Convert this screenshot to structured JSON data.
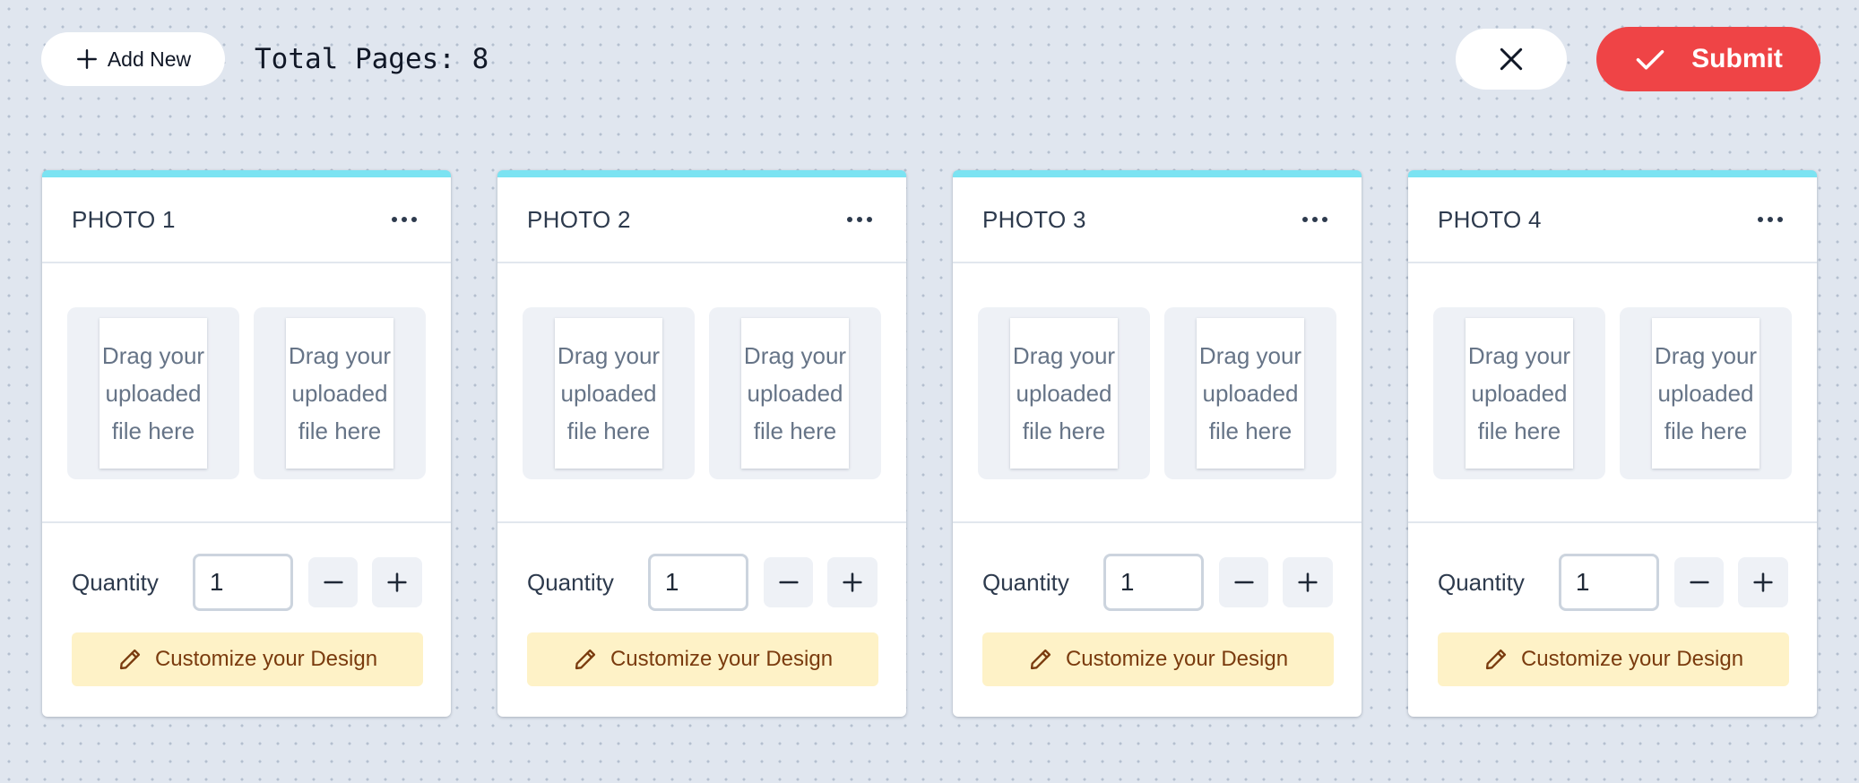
{
  "toolbar": {
    "add_new_label": "Add New",
    "total_pages_text": "Total Pages: 8",
    "submit_label": "Submit",
    "add_icon": "plus-icon",
    "close_icon": "close-icon",
    "submit_icon": "check-icon"
  },
  "colors": {
    "accent_top_border": "#7be3f2",
    "submit": "#ef4446",
    "customize_bg": "#fef2c7",
    "customize_text": "#7a3b0e",
    "background": "#e0e6ef"
  },
  "cards": [
    {
      "title": "PHOTO 1",
      "slots": [
        "Drag your uploaded file here",
        "Drag your uploaded file here"
      ],
      "quantity_label": "Quantity",
      "quantity": "1",
      "customize_label": "Customize your Design"
    },
    {
      "title": "PHOTO 2",
      "slots": [
        "Drag your uploaded file here",
        "Drag your uploaded file here"
      ],
      "quantity_label": "Quantity",
      "quantity": "1",
      "customize_label": "Customize your Design"
    },
    {
      "title": "PHOTO 3",
      "slots": [
        "Drag your uploaded file here",
        "Drag your uploaded file here"
      ],
      "quantity_label": "Quantity",
      "quantity": "1",
      "customize_label": "Customize your Design"
    },
    {
      "title": "PHOTO 4",
      "slots": [
        "Drag your uploaded file here",
        "Drag your uploaded file here"
      ],
      "quantity_label": "Quantity",
      "quantity": "1",
      "customize_label": "Customize your Design"
    }
  ]
}
